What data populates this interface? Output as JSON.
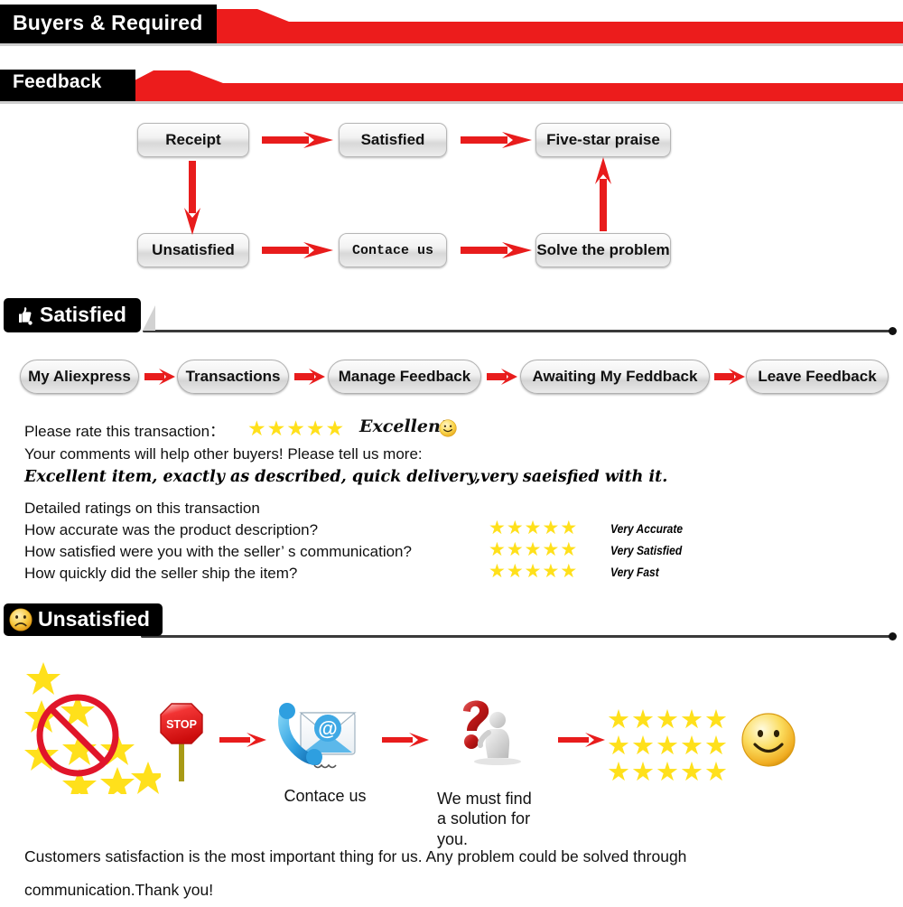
{
  "banners": [
    {
      "id": "buyers",
      "label": "Buyers & Required",
      "bg": "#000000",
      "accent": "#ec1c1c"
    },
    {
      "id": "feedback",
      "label": "Feedback",
      "bg": "#000000",
      "accent": "#ec1c1c"
    }
  ],
  "flow": {
    "nodes": [
      {
        "label": "Receipt"
      },
      {
        "label": "Satisfied"
      },
      {
        "label": "Five-star praise"
      },
      {
        "label": "Unsatisfied"
      },
      {
        "label": "Contace us"
      },
      {
        "label": "Solve the problem"
      }
    ],
    "arrow_color": "#e81c1c"
  },
  "satisfied_section": {
    "badge_label": "Satisfied",
    "badge_icon": "thumbs-up-icon",
    "breadcrumbs": [
      {
        "label": "My Aliexpress"
      },
      {
        "label": "Transactions"
      },
      {
        "label": "Manage Feedback"
      },
      {
        "label": "Awaiting My Feddback"
      },
      {
        "label": "Leave Feedback"
      }
    ],
    "rate_prompt": "Please rate this transaction：",
    "rate_stars": 5,
    "rate_word": "Excellent",
    "rate_emoji": "slightly-smiling-face-icon",
    "comments_prompt": "Your comments will help other buyers! Please tell us more:",
    "comment_text": "Excellent item, exactly as described, quick delivery,very saeisfied with it.",
    "detailed_heading": "Detailed ratings on this transaction",
    "detailed_rows": [
      {
        "question": "How accurate was the product description?",
        "stars": 5,
        "label": "Very Accurate"
      },
      {
        "question": "How satisfied were you with the seller’ s communication?",
        "stars": 5,
        "label": "Very Satisfied"
      },
      {
        "question": "How quickly did the seller ship the item?",
        "stars": 5,
        "label": "Very Fast"
      }
    ]
  },
  "unsatisfied_section": {
    "badge_label": "Unsatisfied",
    "badge_icon": "frowning-face-icon",
    "steps": [
      {
        "icon": "stars-prohibited-icon",
        "caption": ""
      },
      {
        "icon": "stop-sign-icon",
        "caption": ""
      },
      {
        "icon": "phone-email-icon",
        "caption": "Contace us"
      },
      {
        "icon": "question-mark-person-icon",
        "caption": "We must find\na solution for\nyou."
      },
      {
        "icon": "fifteen-stars-icon",
        "caption": ""
      },
      {
        "icon": "smiley-face-icon",
        "caption": ""
      }
    ],
    "bad_stars_count": 9,
    "good_stars_rows": 3,
    "good_stars_per_row": 5
  },
  "footer": {
    "line1": "Customers satisfaction is the most important thing for us. Any problem could be solved through",
    "line2": "communication.Thank you!"
  },
  "colors": {
    "star_yellow": "#FFE01B",
    "red": "#e81c1c",
    "black": "#000000"
  }
}
